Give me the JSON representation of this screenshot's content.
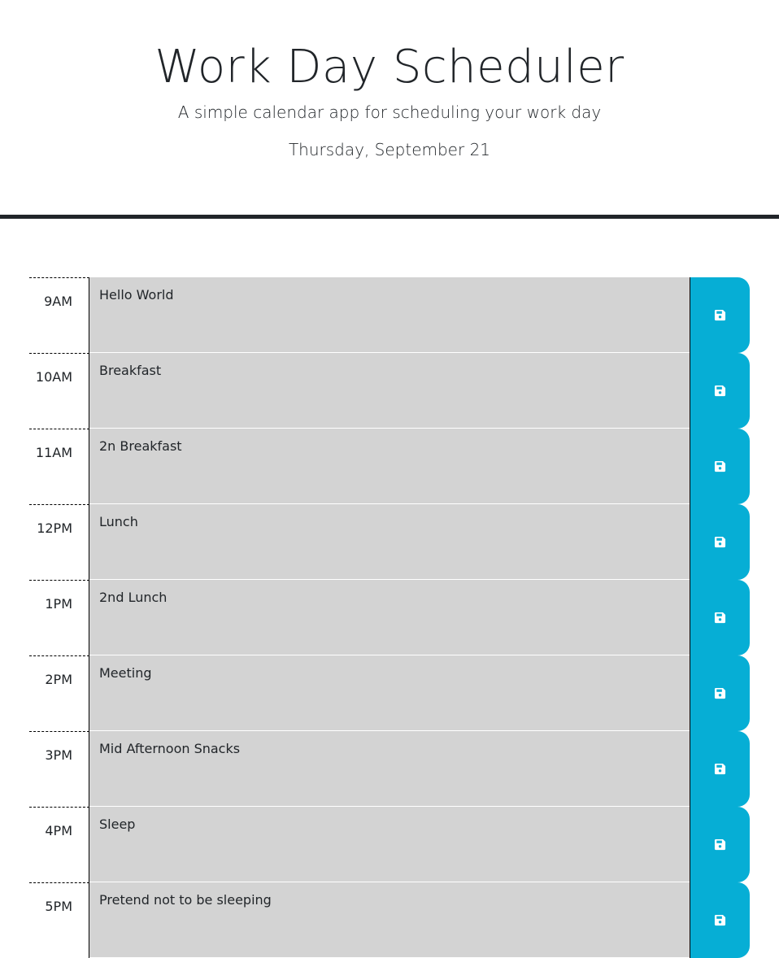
{
  "header": {
    "title": "Work Day Scheduler",
    "subtitle": "A simple calendar app for scheduling your work day",
    "current_day": "Thursday, September 21"
  },
  "colors": {
    "past": "#d3d3d3",
    "save_button": "#06aed5",
    "divider": "#212529"
  },
  "save_icon": "floppy-disk-icon",
  "schedule": [
    {
      "hour": "9AM",
      "description": "Hello World"
    },
    {
      "hour": "10AM",
      "description": "Breakfast"
    },
    {
      "hour": "11AM",
      "description": "2n Breakfast"
    },
    {
      "hour": "12PM",
      "description": "Lunch"
    },
    {
      "hour": "1PM",
      "description": "2nd Lunch"
    },
    {
      "hour": "2PM",
      "description": "Meeting"
    },
    {
      "hour": "3PM",
      "description": "Mid Afternoon Snacks"
    },
    {
      "hour": "4PM",
      "description": "Sleep"
    },
    {
      "hour": "5PM",
      "description": "Pretend not to be sleeping"
    }
  ]
}
